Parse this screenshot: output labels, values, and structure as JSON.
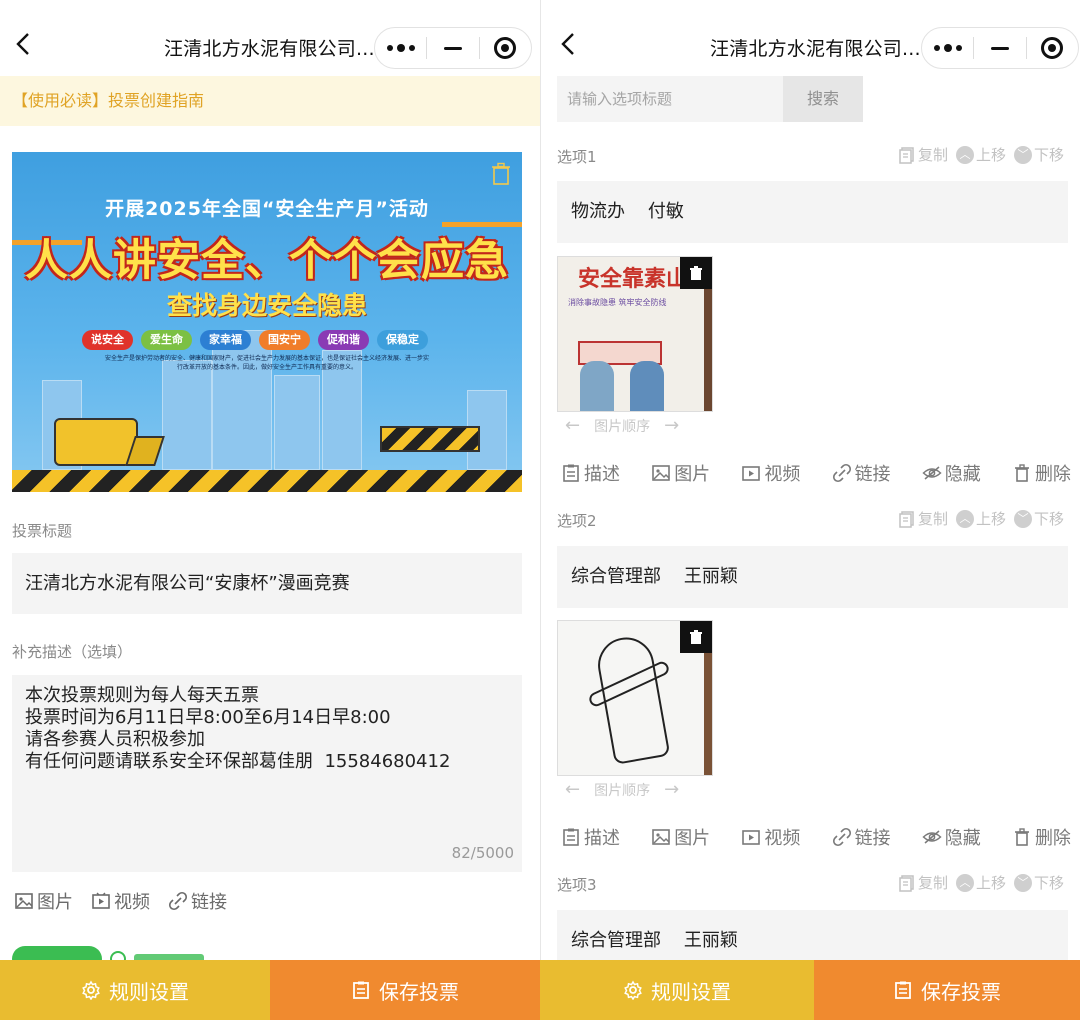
{
  "left": {
    "nav": {
      "title": "汪清北方水泥有限公司..."
    },
    "notice": "【使用必读】投票创建指南",
    "banner": {
      "subtitle": "开展2025年全国“安全生产月”活动",
      "headline": "人人讲安全、个个会应急",
      "slogan": "查找身边安全隐患",
      "pills": [
        {
          "label": "说安全",
          "color": "#e0332b"
        },
        {
          "label": "爱生命",
          "color": "#7cc043"
        },
        {
          "label": "家幸福",
          "color": "#2c7fd3"
        },
        {
          "label": "国安宁",
          "color": "#f07d2a"
        },
        {
          "label": "促和谐",
          "color": "#8a3ab4"
        },
        {
          "label": "保稳定",
          "color": "#3d9fdc"
        }
      ],
      "paragraph": "安全生产是保护劳动者的安全、健康和国家财产，促进社会生产力发展的基本保证，也是保证社会主义经济发展、进一步实行改革开放的基本条件。因此，做好安全生产工作具有重要的意义。"
    },
    "vote_title_label": "投票标题",
    "vote_title_value": "汪清北方水泥有限公司“安康杯”漫画竞赛",
    "desc_label": "补充描述（选填）",
    "desc_lines": [
      "本次投票规则为每人每天五票",
      "投票时间为6月11日早8:00至6月14日早8:00",
      "请各参赛人员积极参加",
      "有任何问题请联系安全环保部葛佳朋  15584680412"
    ],
    "desc_counter": "82/5000",
    "media": {
      "image": "图片",
      "video": "视频",
      "link": "链接"
    }
  },
  "right": {
    "nav": {
      "title": "汪清北方水泥有限公司..."
    },
    "search": {
      "placeholder": "请输入选项标题",
      "button": "搜索"
    },
    "head_actions": {
      "copy": "复制",
      "up": "上移",
      "down": "下移"
    },
    "order_label": "图片顺序",
    "tools": {
      "desc": "描述",
      "image": "图片",
      "video": "视频",
      "link": "链接",
      "hide": "隐藏",
      "delete": "删除"
    },
    "options": [
      {
        "label": "选项1",
        "value": "物流办    付敏"
      },
      {
        "label": "选项2",
        "value": "综合管理部    王丽颖"
      },
      {
        "label": "选项3",
        "value": "综合管理部    王丽颖"
      }
    ]
  },
  "footer": {
    "rule": "规则设置",
    "save": "保存投票"
  },
  "colors": {
    "accent_yellow": "#e9bc30",
    "accent_orange": "#f08a2f",
    "notice_text": "#e0a325",
    "notice_bg": "#fdf7df",
    "green": "#3bbd52"
  }
}
